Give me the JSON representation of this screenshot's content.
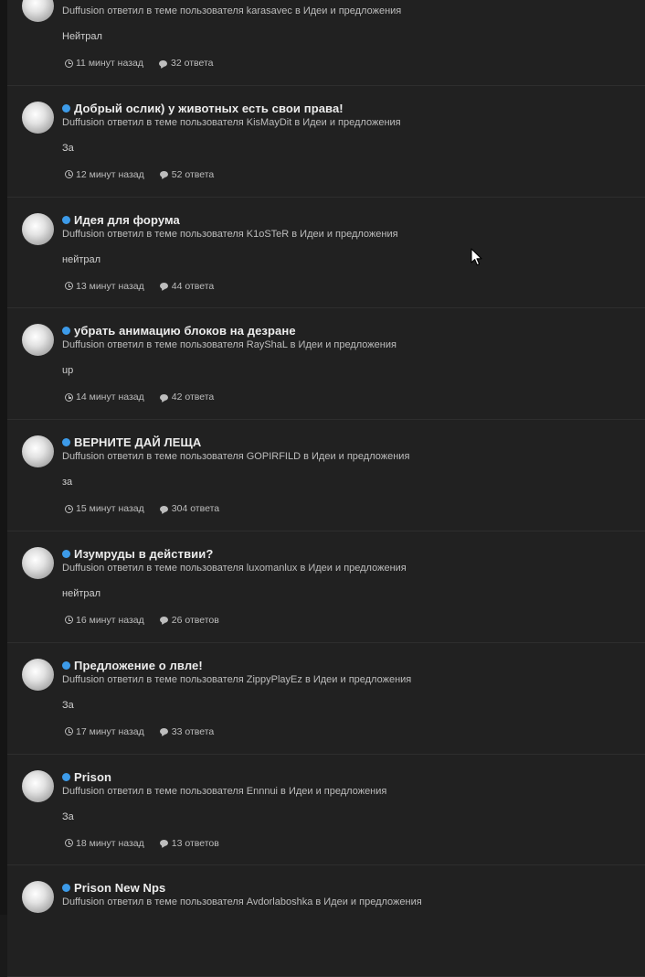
{
  "items": [
    {
      "title": "",
      "meta": "Duffusion ответил в теме пользователя karasavec в Идеи и предложения",
      "excerpt": "Нейтрал",
      "time": "11 минут назад",
      "replies": "32 ответа"
    },
    {
      "title": "Добрый ослик) у животных есть свои права!",
      "meta": "Duffusion ответил в теме пользователя KisMayDit в Идеи и предложения",
      "excerpt": "За",
      "time": "12 минут назад",
      "replies": "52 ответа"
    },
    {
      "title": "Идея для форума",
      "meta": "Duffusion ответил в теме пользователя K1oSTeR в Идеи и предложения",
      "excerpt": "нейтрал",
      "time": "13 минут назад",
      "replies": "44 ответа"
    },
    {
      "title": "убрать анимацию блоков на дезране",
      "meta": "Duffusion ответил в теме пользователя RayShaL в Идеи и предложения",
      "excerpt": "up",
      "time": "14 минут назад",
      "replies": "42 ответа"
    },
    {
      "title": "ВЕРНИТЕ ДАЙ ЛЕЩА",
      "meta": "Duffusion ответил в теме пользователя GOPIRFILD в Идеи и предложения",
      "excerpt": "за",
      "time": "15 минут назад",
      "replies": "304 ответа"
    },
    {
      "title": "Изумруды в действии?",
      "meta": "Duffusion ответил в теме пользователя luxomanlux в Идеи и предложения",
      "excerpt": "нейтрал",
      "time": "16 минут назад",
      "replies": "26 ответов"
    },
    {
      "title": "Предложение о лвле!",
      "meta": "Duffusion ответил в теме пользователя ZippyPlayEz в Идеи и предложения",
      "excerpt": "За",
      "time": "17 минут назад",
      "replies": "33 ответа"
    },
    {
      "title": "Prison",
      "meta": "Duffusion ответил в теме пользователя Ennnui в Идеи и предложения",
      "excerpt": "За",
      "time": "18 минут назад",
      "replies": "13 ответов"
    },
    {
      "title": "Prison New Nps",
      "meta": "Duffusion ответил в теме пользователя Avdorlaboshka в Идеи и предложения",
      "excerpt": "",
      "time": "",
      "replies": ""
    }
  ],
  "colors": {
    "unread_dot": "#3d9be9",
    "panel": "#212121",
    "title_text": "#ececec"
  },
  "icons": {
    "time": "clock-icon",
    "replies": "comment-icon",
    "unread": "unread-dot-icon"
  }
}
